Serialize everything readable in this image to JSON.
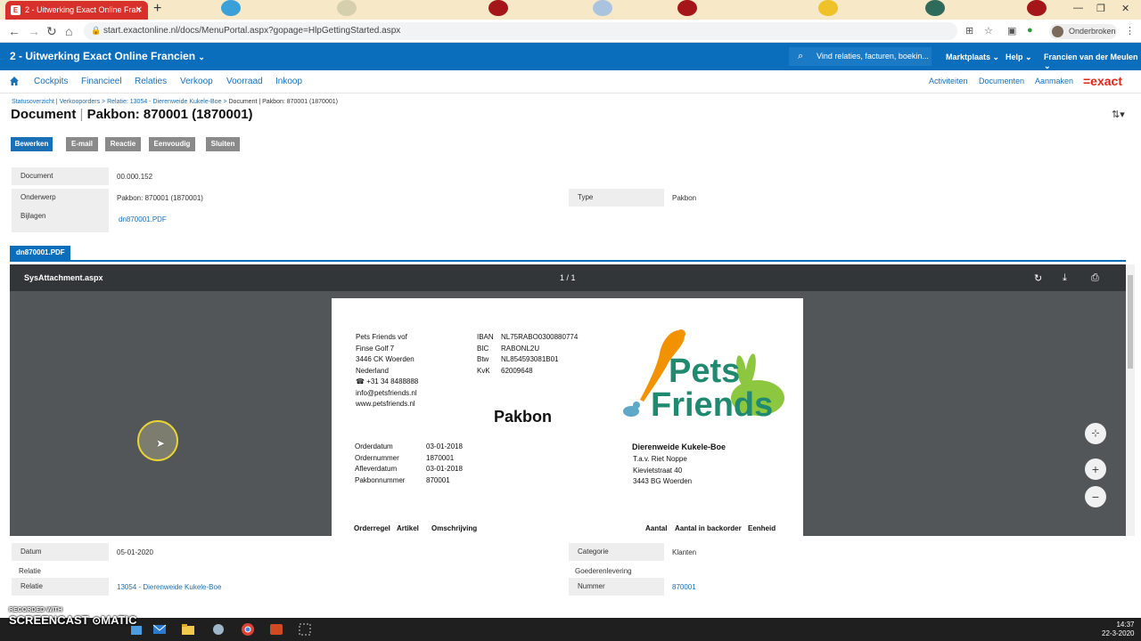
{
  "browser": {
    "tab_title": "2 - Uitwerking Exact Online Fran",
    "tab_favicon": "E",
    "url": "start.exactonline.nl/docs/MenuPortal.aspx?gopage=HlpGettingStarted.aspx",
    "profile_label": "Onderbroken"
  },
  "header": {
    "company": "2 - Uitwerking Exact Online Francien",
    "search_placeholder": "Vind relaties, facturen, boekin...",
    "menus": [
      "Marktplaats",
      "Help",
      "Francien van der Meulen"
    ]
  },
  "menubar": {
    "items": [
      "Cockpits",
      "Financieel",
      "Relaties",
      "Verkoop",
      "Voorraad",
      "Inkoop"
    ],
    "right_items": [
      "Activiteiten",
      "Documenten",
      "Aanmaken"
    ],
    "logo": "=exact"
  },
  "breadcrumb": {
    "links": [
      "Statusoverzicht",
      "Verkooporders",
      "Relatie: 13054 - Dierenweide Kukele-Boe"
    ],
    "current": "Document | Pakbon: 870001 (1870001)"
  },
  "page_title": {
    "prefix": "Document",
    "main": "Pakbon: 870001 (1870001)"
  },
  "buttons": [
    "Bewerken",
    "E-mail",
    "Reactie",
    "Eenvoudig",
    "Sluiten"
  ],
  "fields": {
    "document_label": "Document",
    "document_value": "00.000.152",
    "onderwerp_label": "Onderwerp",
    "onderwerp_value": "Pakbon: 870001 (1870001)",
    "type_label": "Type",
    "type_value": "Pakbon",
    "bijlagen_label": "Bijlagen",
    "bijlagen_value": "dn870001.PDF"
  },
  "attachment_tab": "dn870001.PDF",
  "viewer": {
    "filename": "SysAttachment.aspx",
    "page_indicator": "1 / 1"
  },
  "pdf": {
    "sender": [
      "Pets Friends vof",
      "Finse Golf 7",
      "3446 CK  Woerden",
      "Nederland",
      "☎ +31 34 8488888",
      "info@petsfriends.nl",
      "www.petsfriends.nl"
    ],
    "bank_labels": [
      "IBAN",
      "BIC",
      "Btw",
      "KvK"
    ],
    "bank_values": [
      "NL75RABO0300880774",
      "RABONL2U",
      "NL854593081B01",
      "62009648"
    ],
    "logo_line1": "Pets",
    "logo_line2": "Friends",
    "title": "Pakbon",
    "order_labels": [
      "Orderdatum",
      "Ordernummer",
      "Afleverdatum",
      "Pakbonnummer"
    ],
    "order_values": [
      "03-01-2018",
      "1870001",
      "03-01-2018",
      "870001"
    ],
    "recipient_name": "Dierenweide Kukele-Boe",
    "recipient_lines": [
      "T.a.v.  Riet Noppe",
      "Kievietstraat 40",
      "3443 BG  Woerden"
    ],
    "table_headers": [
      "Orderregel",
      "Artikel",
      "Omschrijving",
      "Aantal",
      "Aantal in backorder",
      "Eenheid"
    ]
  },
  "bottom_fields": {
    "datum_label": "Datum",
    "datum_value": "05-01-2020",
    "categorie_label": "Categorie",
    "categorie_value": "Klanten",
    "relatie_section": "Relatie",
    "goederen_section": "Goederenlevering",
    "relatie_label": "Relatie",
    "relatie_value": "13054 - Dierenweide Kukele-Boe",
    "nummer_label": "Nummer",
    "nummer_value": "870001"
  },
  "taskbar": {
    "time": "14:37",
    "date": "22-3-2020"
  },
  "watermark": {
    "line1": "RECORDED WITH",
    "line2": "SCREENCAST",
    "line3": "MATIC"
  },
  "colors": {
    "brand_blue": "#0a6ebd",
    "exact_red": "#e1261c",
    "logo_orange": "#f39200",
    "logo_teal": "#1f8a70",
    "logo_green": "#8dc63f"
  }
}
